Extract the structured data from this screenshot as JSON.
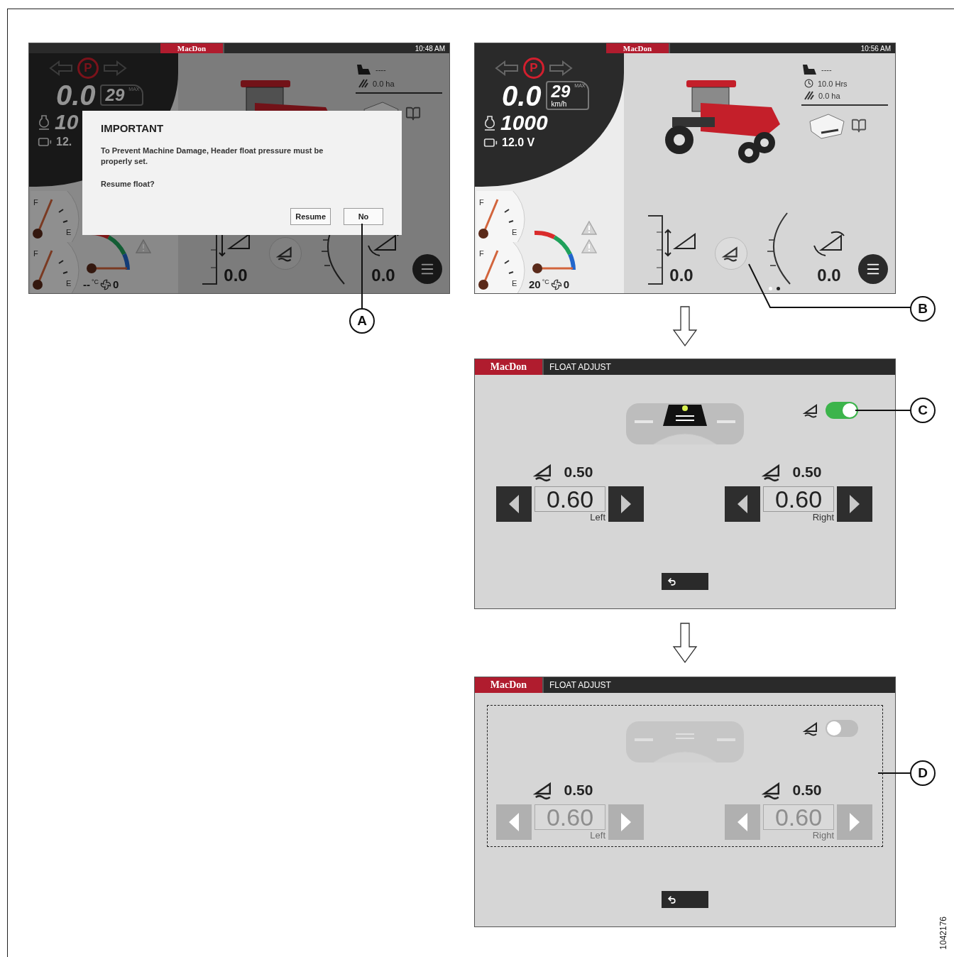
{
  "figure_id": "1042176",
  "screens": [
    {
      "kind": "dashboard",
      "brand": "MacDon",
      "time": "10:48 AM",
      "parking_indicator": "P",
      "speed": "0.0",
      "max_speed": "29",
      "max_label": "MAX",
      "rpm": "10",
      "voltage": "12.",
      "distance": "----",
      "area": "0.0 ha",
      "height_reading": "0.0",
      "tilt_reading": "0.0",
      "gauges": [
        {
          "full_mark": "F",
          "empty_mark": "E"
        },
        {
          "full_mark": "F",
          "empty_mark": "E"
        }
      ],
      "temperature": "--",
      "temperature_unit": "°C",
      "fan_count": "0",
      "dialog": {
        "title": "IMPORTANT",
        "message": "To Prevent Machine Damage, Header float pressure must be properly set.",
        "question": "Resume float?",
        "buttons": [
          {
            "label": "Resume"
          },
          {
            "label": "No"
          }
        ]
      },
      "callout": "A"
    },
    {
      "kind": "dashboard",
      "brand": "MacDon",
      "time": "10:56 AM",
      "parking_indicator": "P",
      "speed": "0.0",
      "max_speed": "29",
      "max_label": "MAX",
      "speed_unit": "km/h",
      "rpm": "1000",
      "voltage": "12.0 V",
      "distance": "----",
      "hours": "10.0 Hrs",
      "area": "0.0 ha",
      "height_reading": "0.0",
      "tilt_reading": "0.0",
      "gauges": [
        {
          "full_mark": "F",
          "empty_mark": "E"
        },
        {
          "full_mark": "F",
          "empty_mark": "E"
        }
      ],
      "temperature": "20",
      "temperature_unit": "°C",
      "fan_count": "0",
      "page_dots": [
        {
          "selected": false
        },
        {
          "selected": true
        }
      ],
      "callout": "B"
    },
    {
      "kind": "float-adjust",
      "brand": "MacDon",
      "title": "FLOAT ADJUST",
      "float_enabled": true,
      "dashed_outline": false,
      "sides": [
        {
          "reading": "0.50",
          "value": "0.60",
          "label": "Left"
        },
        {
          "reading": "0.50",
          "value": "0.60",
          "label": "Right"
        }
      ],
      "callout": "C"
    },
    {
      "kind": "float-adjust",
      "brand": "MacDon",
      "title": "FLOAT ADJUST",
      "float_enabled": false,
      "dashed_outline": true,
      "sides": [
        {
          "reading": "0.50",
          "value": "0.60",
          "label": "Left"
        },
        {
          "reading": "0.50",
          "value": "0.60",
          "label": "Right"
        }
      ],
      "callout": "D"
    }
  ]
}
